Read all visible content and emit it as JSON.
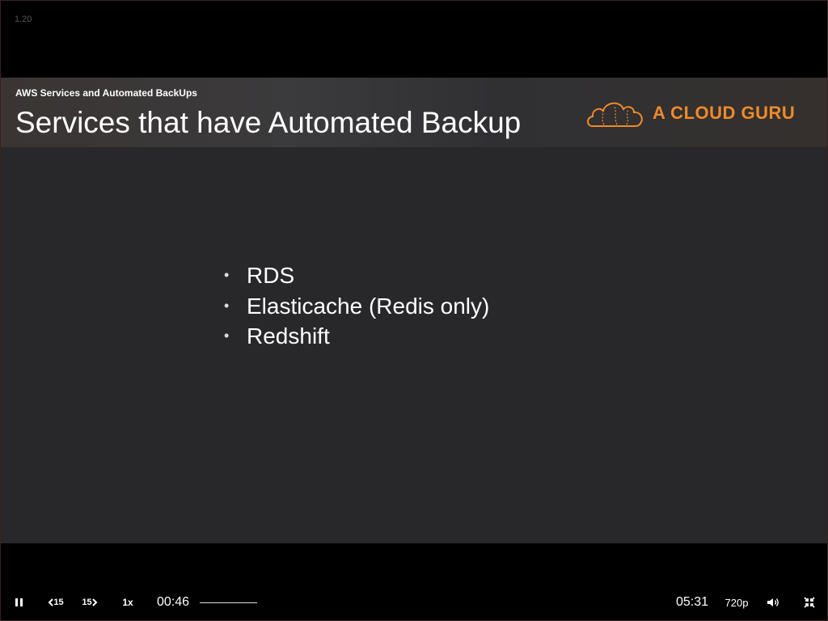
{
  "player": {
    "version_label": "1.20",
    "controls": {
      "play_state": "playing",
      "pause_icon": "pause-icon",
      "rewind_label": "15",
      "forward_label": "15",
      "speed_label": "1x",
      "current_time": "00:46",
      "duration": "05:31",
      "quality_label": "720p",
      "volume_icon": "volume-icon",
      "fullscreen_icon": "exit-fullscreen-icon"
    }
  },
  "slide": {
    "kicker": "AWS Services and Automated BackUps",
    "title": "Services that have Automated Backup",
    "brand": "A CLOUD GURU",
    "brand_color": "#f08a2b",
    "bullets": [
      "RDS",
      "Elasticache (Redis only)",
      "Redshift"
    ]
  }
}
